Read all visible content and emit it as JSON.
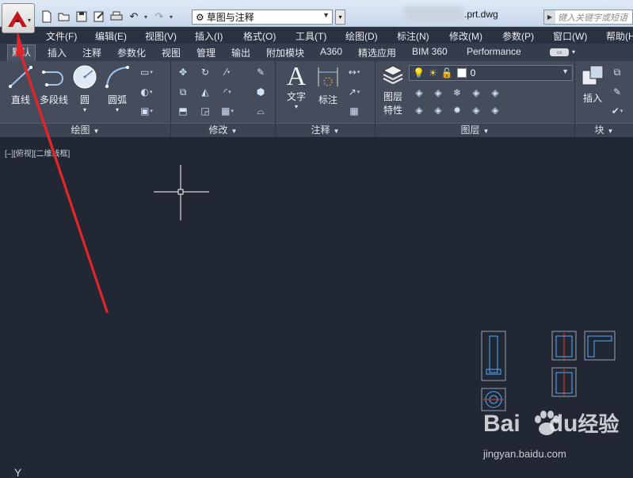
{
  "app": {
    "filename": ".prt.dwg",
    "workspace": "草图与注释",
    "search_placeholder": "键入关键字或短语"
  },
  "menu": [
    "文件(F)",
    "编辑(E)",
    "视图(V)",
    "插入(I)",
    "格式(O)",
    "工具(T)",
    "绘图(D)",
    "标注(N)",
    "修改(M)",
    "参数(P)",
    "窗口(W)",
    "帮助(H)"
  ],
  "tabs": [
    "默认",
    "插入",
    "注释",
    "参数化",
    "视图",
    "管理",
    "输出",
    "附加模块",
    "A360",
    "精选应用",
    "BIM 360",
    "Performance"
  ],
  "ribbon": {
    "draw": {
      "title": "绘图",
      "tools": [
        "直线",
        "多段线",
        "圆",
        "圆弧"
      ]
    },
    "modify": {
      "title": "修改"
    },
    "annotation": {
      "title": "注释",
      "tools": [
        "文字",
        "标注"
      ]
    },
    "layers": {
      "title": "图层",
      "properties_label_1": "图层",
      "properties_label_2": "特性",
      "current_layer": "0"
    },
    "block": {
      "title": "块",
      "insert_label": "插入"
    }
  },
  "viewport": {
    "label": "[–][俯视][二维线框]",
    "ucs_label": "Y"
  },
  "watermark": {
    "brand": "Bai",
    "brand_suffix": "du",
    "brand_cn": "经验",
    "url": "jingyan.baidu.com"
  },
  "colors": {
    "accent_red": "#e0262a",
    "canvas": "#212733",
    "ribbon": "#454d5c"
  }
}
